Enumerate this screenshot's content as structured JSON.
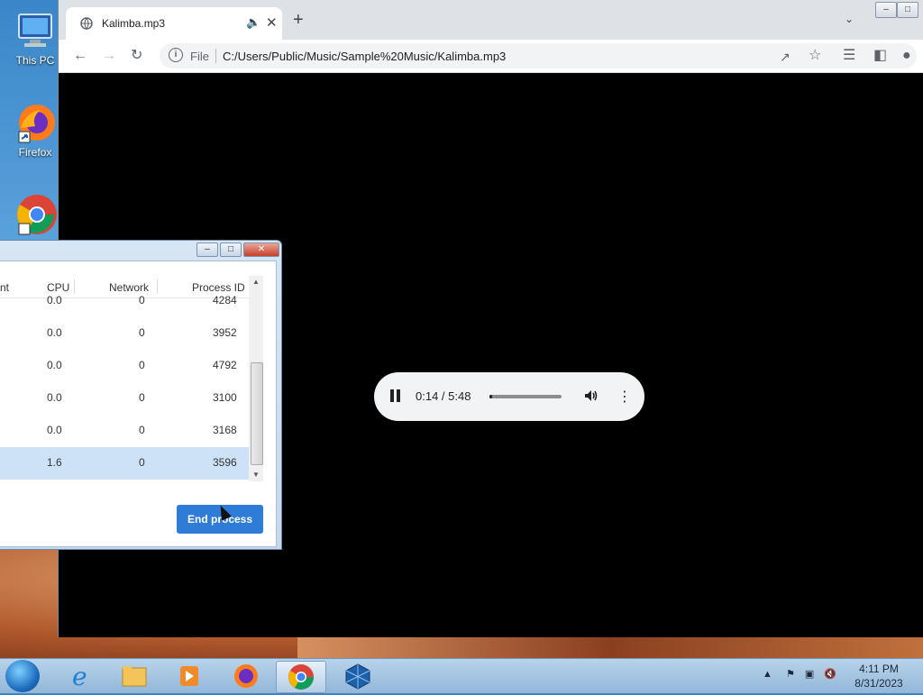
{
  "desktop": {
    "icons": [
      {
        "label": "This PC"
      },
      {
        "label": "Firefox"
      },
      {
        "label": ""
      }
    ]
  },
  "browser": {
    "tab": {
      "title": "Kalimba.mp3"
    },
    "omnibox": {
      "scheme_label": "File",
      "url": "C:/Users/Public/Music/Sample%20Music/Kalimba.mp3"
    },
    "player": {
      "time": "0:14 / 5:48",
      "progress": 0.04
    }
  },
  "task_manager": {
    "columns": [
      "nt",
      "CPU",
      "Network",
      "Process ID"
    ],
    "rows": [
      {
        "cpu": "0.0",
        "network": "0",
        "pid": "4284",
        "selected": false
      },
      {
        "cpu": "0.0",
        "network": "0",
        "pid": "3952",
        "selected": false
      },
      {
        "cpu": "0.0",
        "network": "0",
        "pid": "4792",
        "selected": false
      },
      {
        "cpu": "0.0",
        "network": "0",
        "pid": "3100",
        "selected": false
      },
      {
        "cpu": "0.0",
        "network": "0",
        "pid": "3168",
        "selected": false
      },
      {
        "cpu": "1.6",
        "network": "0",
        "pid": "3596",
        "selected": true
      }
    ],
    "end_button": "End process"
  },
  "taskbar": {
    "clock_time": "4:11 PM",
    "clock_date": "8/31/2023"
  }
}
